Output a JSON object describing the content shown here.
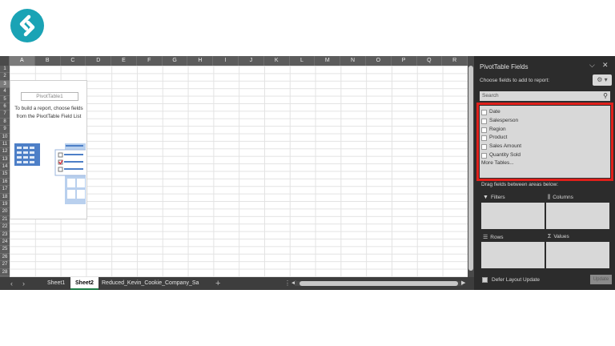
{
  "columns": [
    "A",
    "B",
    "C",
    "D",
    "E",
    "F",
    "G",
    "H",
    "I",
    "J",
    "K",
    "L",
    "M",
    "N",
    "O",
    "P",
    "Q",
    "R"
  ],
  "rows": [
    "1",
    "2",
    "3",
    "4",
    "5",
    "6",
    "7",
    "8",
    "9",
    "10",
    "11",
    "12",
    "13",
    "14",
    "15",
    "16",
    "17",
    "18",
    "19",
    "20",
    "21",
    "22",
    "23",
    "24",
    "25",
    "26",
    "27",
    "28"
  ],
  "pivot_placeholder": {
    "name": "PivotTable1",
    "instruction": "To build a report, choose fields from the PivotTable Field List"
  },
  "sheets": [
    {
      "label": "Sheet1",
      "active": false
    },
    {
      "label": "Sheet2",
      "active": true
    },
    {
      "label": "Reduced_Kevin_Cookie_Company_Sa",
      "active": false
    }
  ],
  "tab_more": "⋮",
  "add_sheet": "+",
  "pane": {
    "title": "PivotTable Fields",
    "subtitle": "Choose fields to add to report:",
    "search_placeholder": "Search",
    "fields": [
      "Date",
      "Salesperson",
      "Region",
      "Product",
      "Sales Amount",
      "Quantity Sold"
    ],
    "more_tables": "More Tables...",
    "drag_label": "Drag fields between areas below:",
    "areas": {
      "filters": "Filters",
      "columns": "Columns",
      "rows": "Rows",
      "values": "Values"
    },
    "defer_label": "Defer Layout Update",
    "update_label": "Update"
  },
  "icons": {
    "logo": "brand-logo",
    "gear": "gear-icon",
    "search": "search-icon",
    "collapse": "chevron-down-icon",
    "close": "close-icon"
  },
  "colors": {
    "logo": "#1aa3b5",
    "highlight": "#e0201b",
    "excel_green": "#1d7a45",
    "pane_bg": "#2c2c2c"
  }
}
